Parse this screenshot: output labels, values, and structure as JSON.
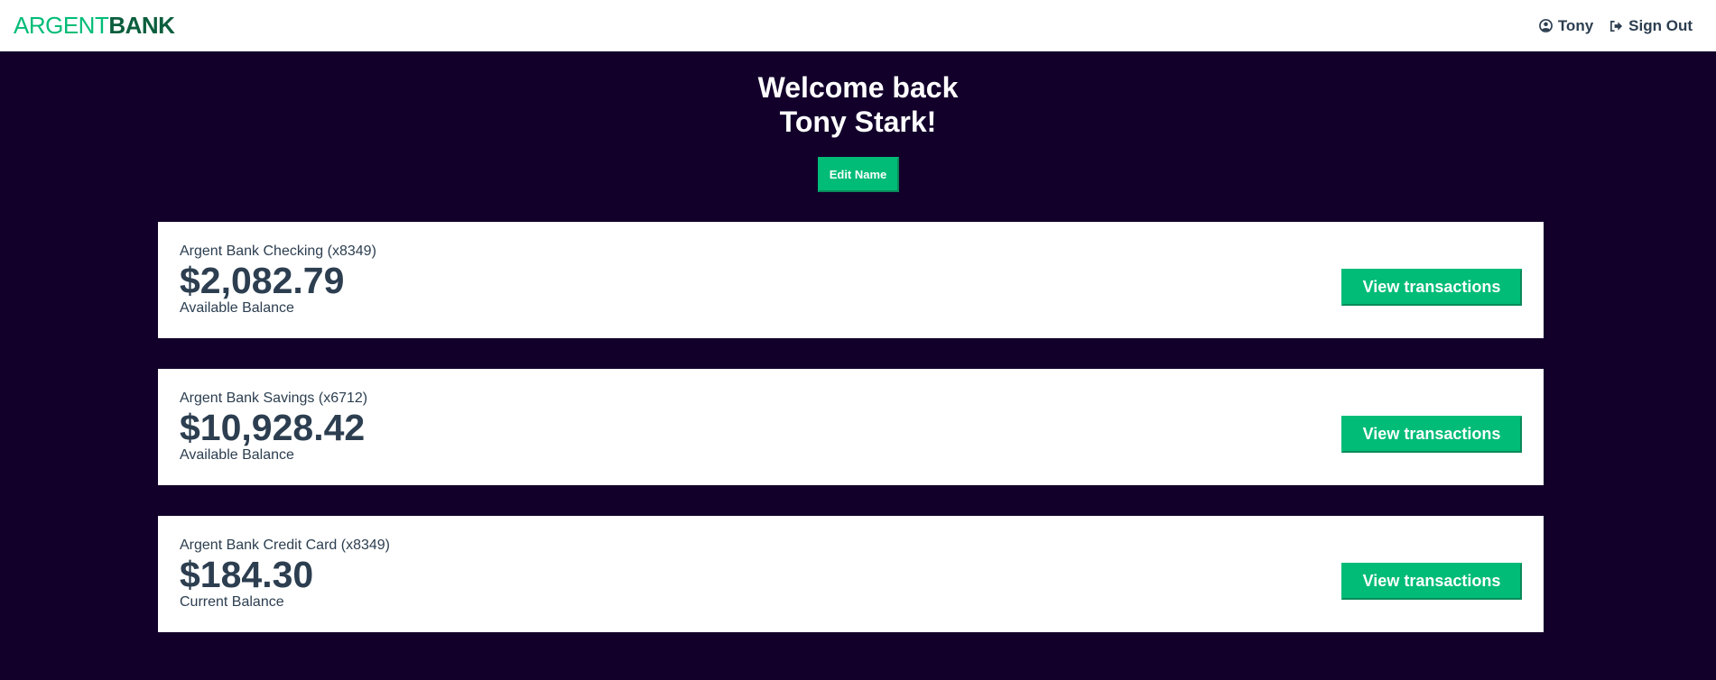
{
  "nav": {
    "logo_part1": "ARGENT",
    "logo_part2": "BANK",
    "user_icon": "user-circle-icon",
    "user_label": "Tony",
    "signout_icon": "sign-out-icon",
    "signout_label": "Sign Out"
  },
  "header": {
    "welcome_line1": "Welcome back",
    "welcome_line2": "Tony Stark!",
    "edit_button": "Edit Name"
  },
  "accounts": [
    {
      "title": "Argent Bank Checking (x8349)",
      "amount": "$2,082.79",
      "description": "Available Balance",
      "button": "View transactions"
    },
    {
      "title": "Argent Bank Savings (x6712)",
      "amount": "$10,928.42",
      "description": "Available Balance",
      "button": "View transactions"
    },
    {
      "title": "Argent Bank Credit Card (x8349)",
      "amount": "$184.30",
      "description": "Current Balance",
      "button": "View transactions"
    }
  ],
  "colors": {
    "background": "#12002b",
    "accent": "#00bc77",
    "logo_dark": "#0b5e3d",
    "text": "#2c3e50"
  }
}
